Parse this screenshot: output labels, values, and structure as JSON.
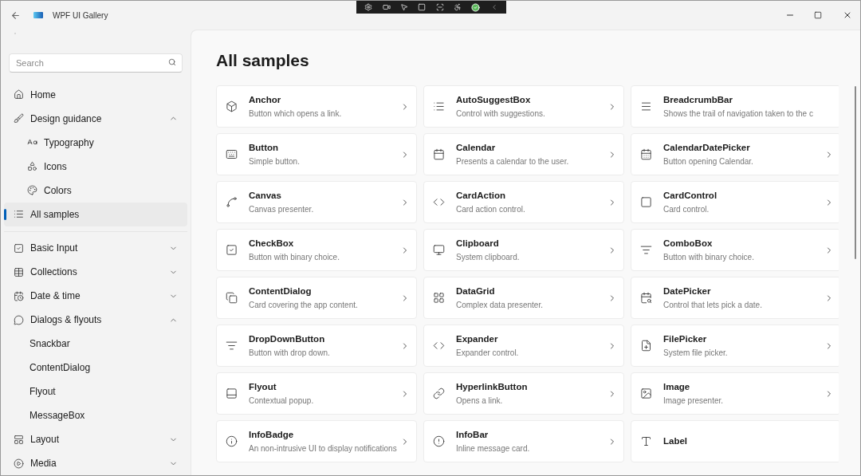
{
  "window": {
    "title": "WPF UI Gallery"
  },
  "sidebar": {
    "search": {
      "placeholder": "Search"
    },
    "items": [
      {
        "label": "Home",
        "selected": false
      },
      {
        "label": "Design guidance",
        "selected": false,
        "expanded": true,
        "children": [
          {
            "label": "Typography",
            "kind": "icon",
            "selected": false
          },
          {
            "label": "Icons",
            "kind": "icon",
            "selected": false
          },
          {
            "label": "Colors",
            "kind": "icon",
            "selected": false
          }
        ]
      },
      {
        "label": "All samples",
        "selected": true
      }
    ],
    "groups": [
      {
        "label": "Basic Input",
        "selected": false,
        "expanded": false
      },
      {
        "label": "Collections",
        "selected": false,
        "expanded": false
      },
      {
        "label": "Date & time",
        "selected": false,
        "expanded": false
      },
      {
        "label": "Dialogs & flyouts",
        "selected": false,
        "expanded": true,
        "children": [
          {
            "label": "Snackbar",
            "kind": "plain",
            "selected": false
          },
          {
            "label": "ContentDialog",
            "kind": "plain",
            "selected": false
          },
          {
            "label": "Flyout",
            "kind": "plain",
            "selected": false
          },
          {
            "label": "MessageBox",
            "kind": "plain",
            "selected": false
          }
        ]
      },
      {
        "label": "Layout",
        "selected": false,
        "expanded": false
      },
      {
        "label": "Media",
        "selected": false,
        "expanded": false
      }
    ]
  },
  "page": {
    "title": "All samples",
    "cards": [
      {
        "title": "Anchor",
        "description": "Button which opens a link.",
        "chevron": true
      },
      {
        "title": "AutoSuggestBox",
        "description": "Control with suggestions.",
        "chevron": true
      },
      {
        "title": "BreadcrumbBar",
        "description": "Shows the trail of navigation taken to the c",
        "chevron": false
      },
      {
        "title": "Button",
        "description": "Simple button.",
        "chevron": true
      },
      {
        "title": "Calendar",
        "description": "Presents a calendar to the user.",
        "chevron": true
      },
      {
        "title": "CalendarDatePicker",
        "description": "Button opening Calendar.",
        "chevron": true
      },
      {
        "title": "Canvas",
        "description": "Canvas presenter.",
        "chevron": true
      },
      {
        "title": "CardAction",
        "description": "Card action control.",
        "chevron": true
      },
      {
        "title": "CardControl",
        "description": "Card control.",
        "chevron": true
      },
      {
        "title": "CheckBox",
        "description": "Button with binary choice.",
        "chevron": true
      },
      {
        "title": "Clipboard",
        "description": "System clipboard.",
        "chevron": true
      },
      {
        "title": "ComboBox",
        "description": "Button with binary choice.",
        "chevron": true
      },
      {
        "title": "ContentDialog",
        "description": "Card covering the app content.",
        "chevron": true
      },
      {
        "title": "DataGrid",
        "description": "Complex data presenter.",
        "chevron": true
      },
      {
        "title": "DatePicker",
        "description": "Control that lets pick a date.",
        "chevron": true
      },
      {
        "title": "DropDownButton",
        "description": "Button with drop down.",
        "chevron": true
      },
      {
        "title": "Expander",
        "description": "Expander control.",
        "chevron": true
      },
      {
        "title": "FilePicker",
        "description": "System file picker.",
        "chevron": true
      },
      {
        "title": "Flyout",
        "description": "Contextual popup.",
        "chevron": true
      },
      {
        "title": "HyperlinkButton",
        "description": "Opens a link.",
        "chevron": true
      },
      {
        "title": "Image",
        "description": "Image presenter.",
        "chevron": true
      },
      {
        "title": "InfoBadge",
        "description": "An non-intrusive UI to display notifications",
        "chevron": true
      },
      {
        "title": "InfoBar",
        "description": "Inline message card.",
        "chevron": true
      },
      {
        "title": "Label",
        "chevron": false
      }
    ]
  }
}
